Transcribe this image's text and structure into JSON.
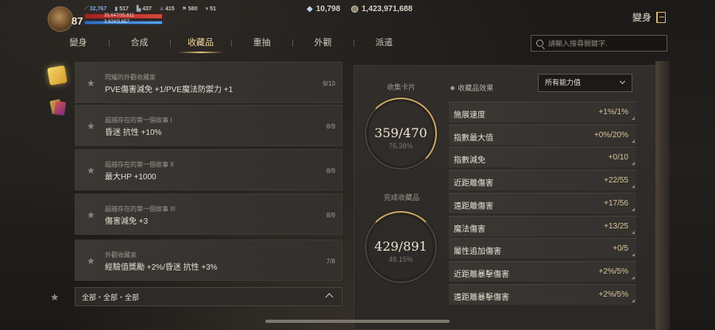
{
  "player": {
    "level": "87",
    "stats": [
      "32,767",
      "517",
      "437",
      "415",
      "580",
      "51"
    ],
    "hp_text": "35,647/35,611",
    "hp_fraction": 0.99,
    "mp_text": "3,624/3,657",
    "mp_fraction": 0.99
  },
  "currency": {
    "gems": "10,798",
    "gold": "1,423,971,688"
  },
  "transform_label": "變身",
  "tabs": [
    {
      "label": "變身"
    },
    {
      "label": "合成"
    },
    {
      "label": "收藏品"
    },
    {
      "label": "重抽"
    },
    {
      "label": "外觀"
    },
    {
      "label": "派遣"
    }
  ],
  "search": {
    "placeholder": "請輸入搜尋關鍵字."
  },
  "collections": [
    {
      "sub": "閃耀的外觀收藏家",
      "main": "PVE傷害減免 +1/PVE魔法防禦力 +1",
      "count": "9/10"
    },
    {
      "sub": "超越存在的第一個故事 I",
      "main": "昏迷 抗性 +10%",
      "count": "8/9"
    },
    {
      "sub": "超越存在的第一個故事 II",
      "main": "最大HP +1000",
      "count": "8/9"
    },
    {
      "sub": "超越存在的第一個故事 III",
      "main": "傷害減免 +3",
      "count": "8/9"
    },
    {
      "sub": "外觀收藏家",
      "main": "經驗值獎勵 +2%/昏迷 抗性 +3%",
      "count": "7/8"
    }
  ],
  "filter_label": "全部・全部・全部",
  "summary": {
    "cards_label": "收集卡片",
    "cards_value": "359/470",
    "cards_pct": "76.38%",
    "done_label": "完成收藏品",
    "done_value": "429/891",
    "done_pct": "48.15%"
  },
  "effects": {
    "title": "收藏品效果",
    "dropdown": "所有能力值",
    "rows": [
      {
        "name": "施展速度",
        "value": "+1%/1%"
      },
      {
        "name": "指數最大值",
        "value": "+0%/20%"
      },
      {
        "name": "指數減免",
        "value": "+0/10"
      },
      {
        "name": "近距離傷害",
        "value": "+22/55"
      },
      {
        "name": "遠距離傷害",
        "value": "+17/56"
      },
      {
        "name": "魔法傷害",
        "value": "+13/25"
      },
      {
        "name": "屬性追加傷害",
        "value": "+0/5"
      },
      {
        "name": "近距離暴擊傷害",
        "value": "+2%/5%"
      },
      {
        "name": "遠距離暴擊傷害",
        "value": "+2%/5%"
      }
    ]
  }
}
